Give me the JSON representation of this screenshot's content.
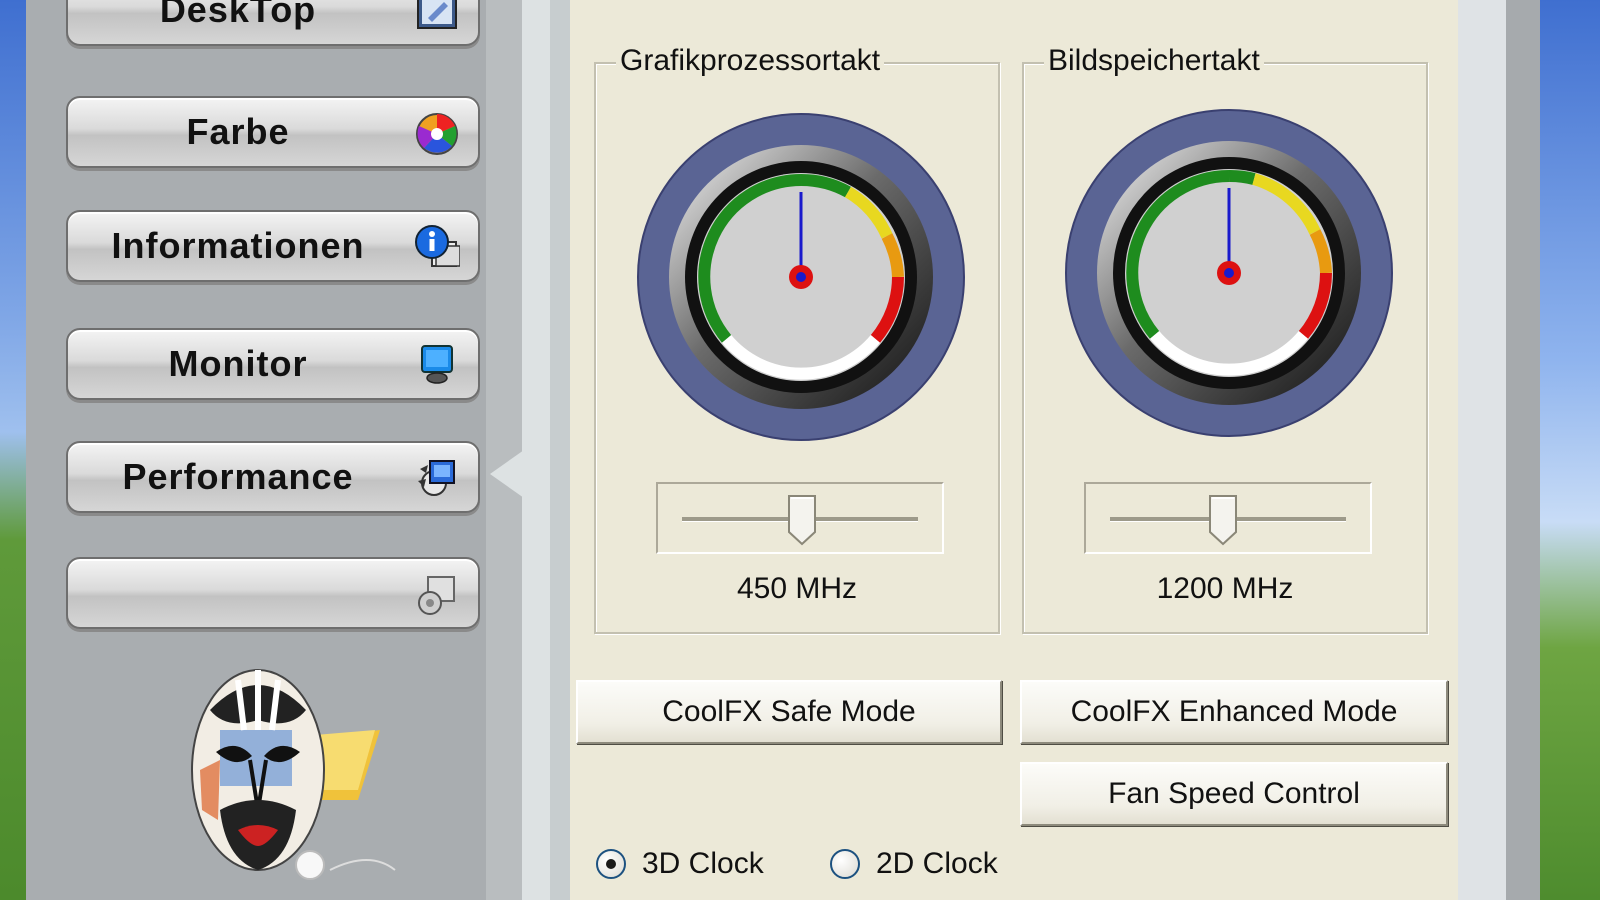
{
  "nav": {
    "items": [
      {
        "label": "DeskTop",
        "icon": "desktop-icon"
      },
      {
        "label": "Farbe",
        "icon": "color-palette-icon"
      },
      {
        "label": "Informationen",
        "icon": "info-icon"
      },
      {
        "label": "Monitor",
        "icon": "monitor-icon"
      },
      {
        "label": "Performance",
        "icon": "performance-icon",
        "active": true
      },
      {
        "label": "",
        "icon": "settings-icon"
      }
    ],
    "logo": "opera-mask-logo"
  },
  "clocks": {
    "gpu": {
      "title": "Grafikprozessortakt",
      "value_label": "450 MHz",
      "slider_level": 0.5
    },
    "memory": {
      "title": "Bildspeichertakt",
      "value_label": "1200 MHz",
      "slider_level": 0.47
    }
  },
  "buttons": {
    "safe_mode": "CoolFX Safe Mode",
    "enhanced_mode": "CoolFX Enhanced Mode",
    "fan_speed": "Fan Speed Control"
  },
  "clock_mode": {
    "options": [
      {
        "label": "3D Clock",
        "selected": true
      },
      {
        "label": "2D Clock",
        "selected": false
      }
    ]
  },
  "colors": {
    "panel_bg": "#ece9d8",
    "gauge_ring": "#5a6494",
    "needle": "#1a1acc",
    "hub": "#dd1111",
    "zone_green": "#1e8c1e",
    "zone_yellow": "#e8d820",
    "zone_orange": "#e89a10",
    "zone_red": "#dd1111"
  }
}
